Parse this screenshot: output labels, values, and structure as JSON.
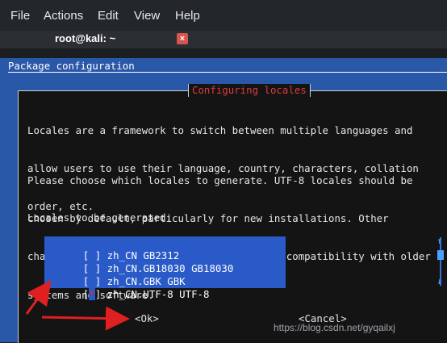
{
  "menubar": {
    "items": [
      "File",
      "Actions",
      "Edit",
      "View",
      "Help"
    ]
  },
  "tab": {
    "title": "root@kali: ~",
    "close_icon": "close-icon"
  },
  "terminal": {
    "header": "Package configuration",
    "dialog_title": "Configuring locales",
    "para1": [
      "Locales are a framework to switch between multiple languages and",
      "allow users to use their language, country, characters, collation",
      "order, etc."
    ],
    "para2": [
      "Please choose which locales to generate. UTF-8 locales should be",
      "chosen by default, particularly for new installations. Other",
      "character sets may be useful for backwards compatibility with older",
      "systems and software."
    ],
    "list_label": "Locales to be generated:",
    "locales": [
      {
        "box_open": "[",
        "mark": " ",
        "box_close": "]",
        "name": "zh_CN GB2312"
      },
      {
        "box_open": "[",
        "mark": " ",
        "box_close": "]",
        "name": "zh_CN.GB18030 GB18030"
      },
      {
        "box_open": "[",
        "mark": " ",
        "box_close": "]",
        "name": "zh_CN.GBK GBK"
      },
      {
        "box_open": "[",
        "mark": "*",
        "box_close": "]",
        "name": "zh_CN.UTF-8 UTF-8"
      }
    ],
    "ok_label": "<Ok>",
    "cancel_label": "<Cancel>"
  },
  "watermark": "https://blog.csdn.net/gyqailxj",
  "colors": {
    "terminal_bg": "#2a58a8",
    "dialog_bg": "#141414",
    "list_bg": "#2a5ac8",
    "title_red": "#e03a3a",
    "arrow_red": "#e02020"
  }
}
